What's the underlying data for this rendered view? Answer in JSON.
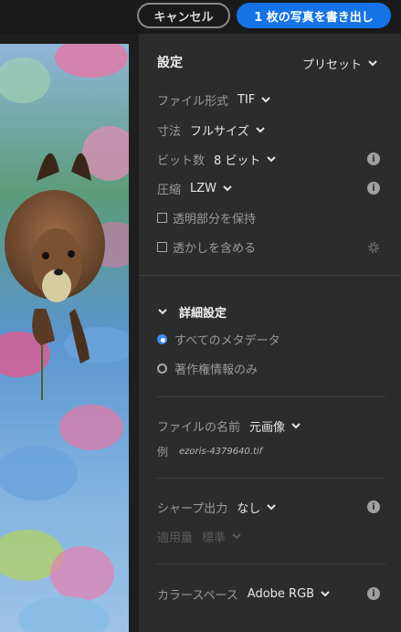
{
  "topbar": {
    "cancel_label": "キャンセル",
    "export_label": "1 枚の写真を書き出し",
    "accent_color": "#1473e6"
  },
  "settings": {
    "title": "設定",
    "preset_label": "プリセット",
    "file_format_label": "ファイル形式",
    "file_format_value": "TIF",
    "dimensions_label": "寸法",
    "dimensions_value": "フルサイズ",
    "bit_depth_label": "ビット数",
    "bit_depth_value": "8 ビット",
    "compression_label": "圧縮",
    "compression_value": "LZW",
    "transparency_label": "透明部分を保持",
    "watermark_label": "透かしを含める",
    "icons": {
      "info": "info-icon",
      "watermark": "gear-icon"
    }
  },
  "advanced": {
    "title": "詳細設定",
    "metadata_all_label": "すべてのメタデータ",
    "metadata_copyright_label": "著作権情報のみ",
    "selected": "すべてのメタデータ",
    "file_name_label": "ファイルの名前",
    "file_name_value": "元画像",
    "example_label": "例",
    "example_value": "ezoris-4379640.tif",
    "sharpen_label": "シャープ出力",
    "sharpen_value": "なし",
    "amount_label": "適用量",
    "amount_value": "標準",
    "color_space_label": "カラースペース",
    "color_space_value": "Adobe RGB"
  }
}
